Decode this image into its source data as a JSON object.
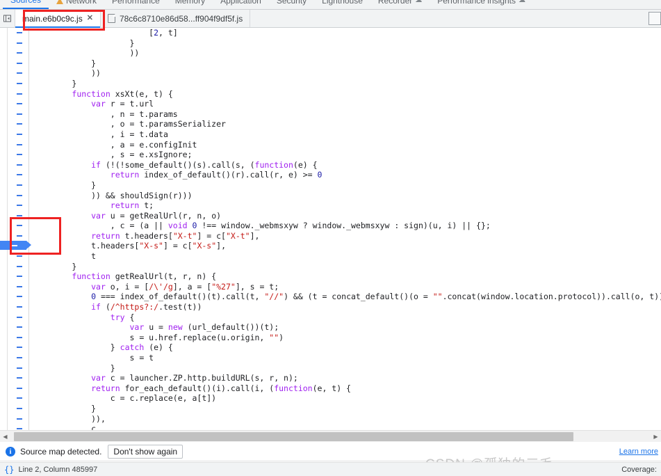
{
  "panel_tabs": [
    {
      "label": "Sources",
      "active": true,
      "badge": "none"
    },
    {
      "label": "Network",
      "active": false,
      "badge": "warning"
    },
    {
      "label": "Performance",
      "active": false,
      "badge": "none"
    },
    {
      "label": "Memory",
      "active": false,
      "badge": "none"
    },
    {
      "label": "Application",
      "active": false,
      "badge": "none"
    },
    {
      "label": "Security",
      "active": false,
      "badge": "none"
    },
    {
      "label": "Lighthouse",
      "active": false,
      "badge": "none"
    },
    {
      "label": "Recorder",
      "active": false,
      "badge": "cloud"
    },
    {
      "label": "Performance insights",
      "active": false,
      "badge": "cloud"
    }
  ],
  "file_tabs": {
    "nav_toggle_icon": "panel-collapse-icon",
    "items": [
      {
        "label": "main.e6b0c9c.js",
        "active": true,
        "closable": true,
        "icon": "none"
      },
      {
        "label": "78c6c8710e86d58...ff904f9df5f.js",
        "active": false,
        "closable": false,
        "icon": "document-icon"
      }
    ]
  },
  "editor": {
    "breakpoint_line_index": 21,
    "lines": [
      {
        "indent": 6,
        "tokens": [
          {
            "t": "[",
            "c": "plain"
          },
          {
            "t": "2",
            "c": "num"
          },
          {
            "t": ", t]",
            "c": "plain"
          }
        ]
      },
      {
        "indent": 5,
        "tokens": [
          {
            "t": "}",
            "c": "plain"
          }
        ]
      },
      {
        "indent": 5,
        "tokens": [
          {
            "t": "))",
            "c": "plain"
          }
        ]
      },
      {
        "indent": 3,
        "tokens": [
          {
            "t": "}",
            "c": "plain"
          }
        ]
      },
      {
        "indent": 3,
        "tokens": [
          {
            "t": "))",
            "c": "plain"
          }
        ]
      },
      {
        "indent": 2,
        "tokens": [
          {
            "t": "}",
            "c": "plain"
          }
        ]
      },
      {
        "indent": 2,
        "tokens": [
          {
            "t": "function",
            "c": "kw"
          },
          {
            "t": " xsXt(e, t) {",
            "c": "plain"
          }
        ]
      },
      {
        "indent": 3,
        "tokens": [
          {
            "t": "var",
            "c": "kw"
          },
          {
            "t": " r = t.url",
            "c": "plain"
          }
        ]
      },
      {
        "indent": 4,
        "tokens": [
          {
            "t": ", n = t.params",
            "c": "plain"
          }
        ]
      },
      {
        "indent": 4,
        "tokens": [
          {
            "t": ", o = t.paramsSerializer",
            "c": "plain"
          }
        ]
      },
      {
        "indent": 4,
        "tokens": [
          {
            "t": ", i = t.data",
            "c": "plain"
          }
        ]
      },
      {
        "indent": 4,
        "tokens": [
          {
            "t": ", a = e.configInit",
            "c": "plain"
          }
        ]
      },
      {
        "indent": 4,
        "tokens": [
          {
            "t": ", s = e.xsIgnore;",
            "c": "plain"
          }
        ]
      },
      {
        "indent": 3,
        "tokens": [
          {
            "t": "if",
            "c": "kw"
          },
          {
            "t": " (!(!some_default()(s).call(s, (",
            "c": "plain"
          },
          {
            "t": "function",
            "c": "kw"
          },
          {
            "t": "(e) {",
            "c": "plain"
          }
        ]
      },
      {
        "indent": 4,
        "tokens": [
          {
            "t": "return",
            "c": "kw"
          },
          {
            "t": " index_of_default()(r).call(r, e) >= ",
            "c": "plain"
          },
          {
            "t": "0",
            "c": "num"
          }
        ]
      },
      {
        "indent": 3,
        "tokens": [
          {
            "t": "}",
            "c": "plain"
          }
        ]
      },
      {
        "indent": 3,
        "tokens": [
          {
            "t": ")) && shouldSign(r)))",
            "c": "plain"
          }
        ]
      },
      {
        "indent": 4,
        "tokens": [
          {
            "t": "return",
            "c": "kw"
          },
          {
            "t": " t;",
            "c": "plain"
          }
        ]
      },
      {
        "indent": 3,
        "tokens": [
          {
            "t": "var",
            "c": "kw"
          },
          {
            "t": " u = getRealUrl(r, n, o)",
            "c": "plain"
          }
        ]
      },
      {
        "indent": 4,
        "tokens": [
          {
            "t": ", c = (a || ",
            "c": "plain"
          },
          {
            "t": "void",
            "c": "kw"
          },
          {
            "t": " ",
            "c": "plain"
          },
          {
            "t": "0",
            "c": "num"
          },
          {
            "t": " !== window._webmsxyw ? window._webmsxyw : sign)(u, i) || {};",
            "c": "plain"
          }
        ]
      },
      {
        "indent": 3,
        "tokens": [
          {
            "t": "return",
            "c": "kw"
          },
          {
            "t": " t.headers[",
            "c": "plain"
          },
          {
            "t": "\"X-t\"",
            "c": "str"
          },
          {
            "t": "] = c[",
            "c": "plain"
          },
          {
            "t": "\"X-t\"",
            "c": "str"
          },
          {
            "t": "],",
            "c": "plain"
          }
        ]
      },
      {
        "indent": 3,
        "tokens": [
          {
            "t": "t.headers[",
            "c": "plain"
          },
          {
            "t": "\"X-s\"",
            "c": "str"
          },
          {
            "t": "] = c[",
            "c": "plain"
          },
          {
            "t": "\"X-s\"",
            "c": "str"
          },
          {
            "t": "],",
            "c": "plain"
          }
        ]
      },
      {
        "indent": 3,
        "tokens": [
          {
            "t": "t",
            "c": "plain"
          }
        ]
      },
      {
        "indent": 2,
        "tokens": [
          {
            "t": "}",
            "c": "plain"
          }
        ]
      },
      {
        "indent": 2,
        "tokens": [
          {
            "t": "function",
            "c": "kw"
          },
          {
            "t": " getRealUrl(t, r, n) {",
            "c": "plain"
          }
        ]
      },
      {
        "indent": 3,
        "tokens": [
          {
            "t": "var",
            "c": "kw"
          },
          {
            "t": " o, i = [",
            "c": "plain"
          },
          {
            "t": "/\\'/g",
            "c": "rgx"
          },
          {
            "t": "], a = [",
            "c": "plain"
          },
          {
            "t": "\"%27\"",
            "c": "str"
          },
          {
            "t": "], s = t;",
            "c": "plain"
          }
        ]
      },
      {
        "indent": 3,
        "tokens": [
          {
            "t": "0",
            "c": "num"
          },
          {
            "t": " === index_of_default()(t).call(t, ",
            "c": "plain"
          },
          {
            "t": "\"//\"",
            "c": "str"
          },
          {
            "t": ") && (t = concat_default()(o = ",
            "c": "plain"
          },
          {
            "t": "\"\"",
            "c": "str"
          },
          {
            "t": ".concat(window.location.protocol)).call(o, t));",
            "c": "plain"
          }
        ]
      },
      {
        "indent": 3,
        "tokens": [
          {
            "t": "if",
            "c": "kw"
          },
          {
            "t": " (",
            "c": "plain"
          },
          {
            "t": "/^https?:/",
            "c": "rgx"
          },
          {
            "t": ".test(t))",
            "c": "plain"
          }
        ]
      },
      {
        "indent": 4,
        "tokens": [
          {
            "t": "try",
            "c": "kw"
          },
          {
            "t": " {",
            "c": "plain"
          }
        ]
      },
      {
        "indent": 5,
        "tokens": [
          {
            "t": "var",
            "c": "kw"
          },
          {
            "t": " u = ",
            "c": "plain"
          },
          {
            "t": "new",
            "c": "kw"
          },
          {
            "t": " (url_default())(t);",
            "c": "plain"
          }
        ]
      },
      {
        "indent": 5,
        "tokens": [
          {
            "t": "s = u.href.replace(u.origin, ",
            "c": "plain"
          },
          {
            "t": "\"\"",
            "c": "str"
          },
          {
            "t": ")",
            "c": "plain"
          }
        ]
      },
      {
        "indent": 4,
        "tokens": [
          {
            "t": "} ",
            "c": "plain"
          },
          {
            "t": "catch",
            "c": "kw"
          },
          {
            "t": " (e) {",
            "c": "plain"
          }
        ]
      },
      {
        "indent": 5,
        "tokens": [
          {
            "t": "s = t",
            "c": "plain"
          }
        ]
      },
      {
        "indent": 4,
        "tokens": [
          {
            "t": "}",
            "c": "plain"
          }
        ]
      },
      {
        "indent": 3,
        "tokens": [
          {
            "t": "var",
            "c": "kw"
          },
          {
            "t": " c = launcher.ZP.http.buildURL(s, r, n);",
            "c": "plain"
          }
        ]
      },
      {
        "indent": 3,
        "tokens": [
          {
            "t": "return",
            "c": "kw"
          },
          {
            "t": " for_each_default()(i).call(i, (",
            "c": "plain"
          },
          {
            "t": "function",
            "c": "kw"
          },
          {
            "t": "(e, t) {",
            "c": "plain"
          }
        ]
      },
      {
        "indent": 4,
        "tokens": [
          {
            "t": "c = c.replace(e, a[t])",
            "c": "plain"
          }
        ]
      },
      {
        "indent": 3,
        "tokens": [
          {
            "t": "}",
            "c": "plain"
          }
        ]
      },
      {
        "indent": 3,
        "tokens": [
          {
            "t": ")),",
            "c": "plain"
          }
        ]
      },
      {
        "indent": 3,
        "tokens": [
          {
            "t": "c",
            "c": "plain"
          }
        ]
      },
      {
        "indent": 2,
        "tokens": [
          {
            "t": "}",
            "c": "plain"
          }
        ]
      }
    ]
  },
  "scrollbar": {
    "left_arrow_icon": "arrow-left-icon",
    "right_arrow_icon": "arrow-right-icon"
  },
  "infobar": {
    "icon": "info-icon",
    "icon_glyph": "i",
    "message": "Source map detected.",
    "dismiss_label": "Don't show again",
    "learn_more_label": "Learn more"
  },
  "statusbar": {
    "braces_glyph": "{}",
    "position_text": "Line 2, Column 485997",
    "coverage_label": "Coverage:"
  },
  "watermark": {
    "text": "CSDN @孤独的三毛"
  },
  "colors": {
    "accent": "#1a73e8",
    "annotation": "#ee2222",
    "breakpoint": "#4285f4",
    "keyword": "#a020f0",
    "string": "#c41a16",
    "number": "#1a1aa6"
  }
}
